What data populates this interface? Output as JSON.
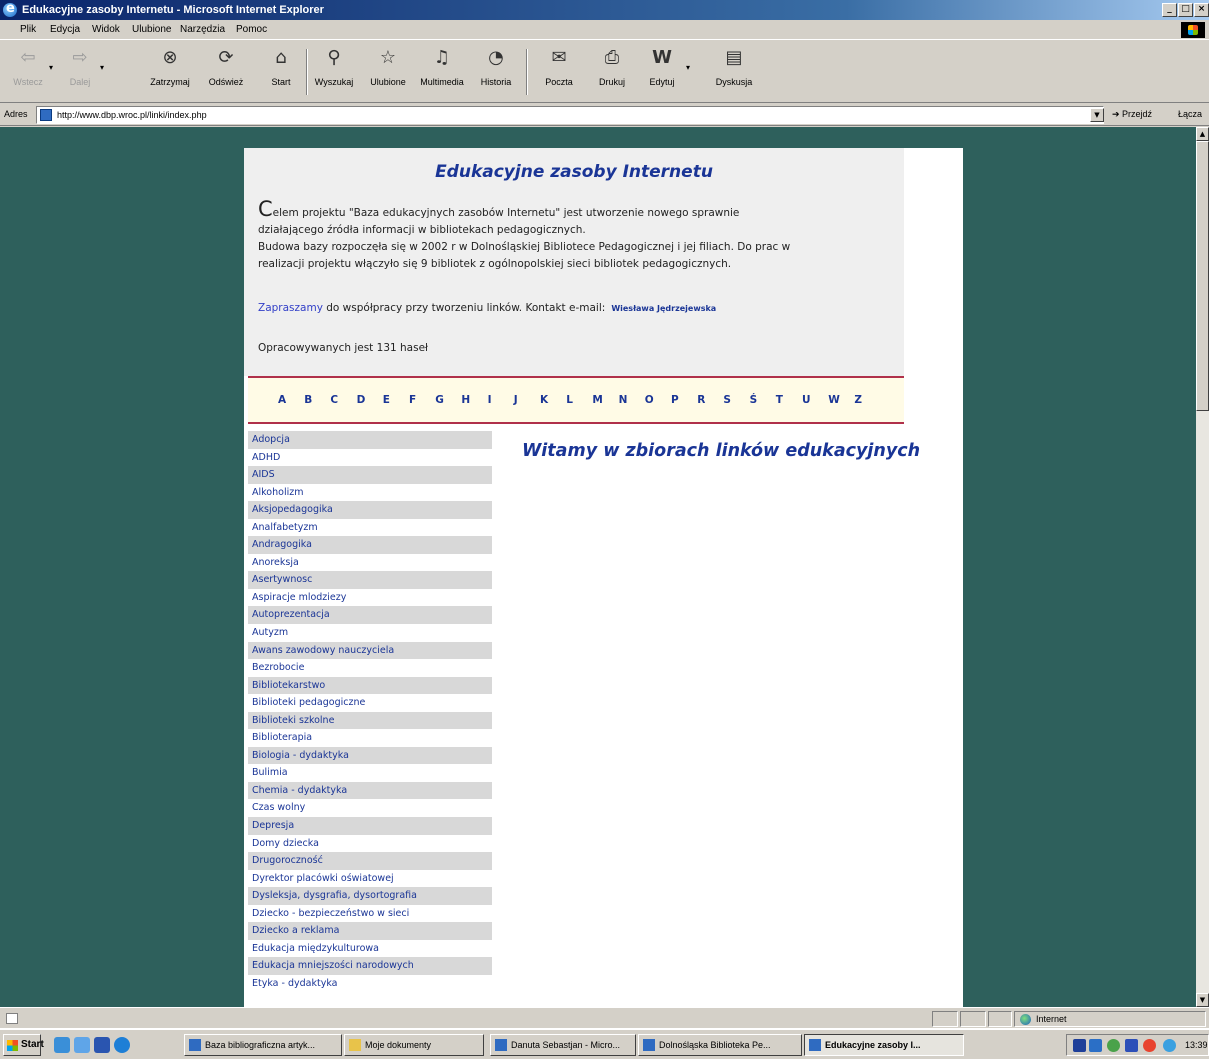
{
  "window": {
    "title": "Edukacyjne zasoby Internetu - Microsoft Internet Explorer"
  },
  "menu": {
    "items": [
      "Plik",
      "Edycja",
      "Widok",
      "Ulubione",
      "Narzędzia",
      "Pomoc"
    ]
  },
  "toolbar": {
    "back": "Wstecz",
    "forward": "Dalej",
    "stop": "Zatrzymaj",
    "refresh": "Odśwież",
    "home": "Start",
    "search": "Wyszukaj",
    "favorites": "Ulubione",
    "multimedia": "Multimedia",
    "history": "Historia",
    "mail": "Poczta",
    "print": "Drukuj",
    "edit": "Edytuj",
    "discuss": "Dyskusja"
  },
  "address": {
    "label": "Adres",
    "url": "http://www.dbp.wroc.pl/linki/index.php",
    "go": "Przejdź",
    "links": "Łącza"
  },
  "page": {
    "title": "Edukacyjne zasoby Internetu",
    "intro_dropcap": "C",
    "intro_line1": "elem projektu \"Baza edukacyjnych zasobów Internetu\" jest utworzenie nowego sprawnie",
    "intro_line2": "działającego źródła informacji w bibliotekach pedagogicznych.",
    "intro_line3": "Budowa bazy rozpoczęła się w 2002 r w Dolnośląskiej Bibliotece Pedagogicznej i jej filiach. Do prac w",
    "intro_line4": "realizacji projektu włączyło się 9 bibliotek z ogólnopolskiej sieci bibliotek pedagogicznych.",
    "invite_link": "Zapraszamy",
    "invite_text": " do współpracy przy tworzeniu linków. Kontakt e-mail:",
    "contact_name": "Wiesława Jędrzejewska",
    "count_text": "Opracowywanych jest 131 haseł",
    "welcome": "Witamy w zbiorach linków edukacyjnych"
  },
  "alphabet": [
    "A",
    "B",
    "C",
    "D",
    "E",
    "F",
    "G",
    "H",
    "I",
    "J",
    "K",
    "L",
    "M",
    "N",
    "O",
    "P",
    "R",
    "S",
    "Ś",
    "T",
    "U",
    "W",
    "Z"
  ],
  "topics": [
    "Adopcja",
    "ADHD",
    "AIDS",
    "Alkoholizm",
    "Aksjopedagogika",
    "Analfabetyzm",
    "Andragogika",
    "Anoreksja",
    "Asertywnosc",
    "Aspiracje mlodziezy",
    "Autoprezentacja",
    "Autyzm",
    "Awans zawodowy nauczyciela",
    "Bezrobocie",
    "Bibliotekarstwo",
    "Biblioteki pedagogiczne",
    "Biblioteki szkolne",
    "Biblioterapia",
    "Biologia - dydaktyka",
    "Bulimia",
    "Chemia - dydaktyka",
    "Czas wolny",
    "Depresja",
    "Domy dziecka",
    "Drugoroczność",
    "Dyrektor placówki oświatowej",
    "Dysleksja, dysgrafia, dysortografia",
    "Dziecko - bezpieczeństwo w sieci",
    "Dziecko a reklama",
    "Edukacja międzykulturowa",
    "Edukacja mniejszości narodowych",
    "Etyka - dydaktyka"
  ],
  "status": {
    "zone": "Internet"
  },
  "taskbar": {
    "start": "Start",
    "tasks": [
      "Baza bibliograficzna artyk...",
      "Moje dokumenty",
      "Danuta Sebastjan - Micro...",
      "Dolnośląska Biblioteka Pe...",
      "Edukacyjne zasoby I..."
    ],
    "clock": "13:39"
  },
  "colors": {
    "page_bg": "#2e605c",
    "heading": "#1a3596",
    "rule": "#b0304a",
    "alpha_bg": "#fffbe6"
  }
}
